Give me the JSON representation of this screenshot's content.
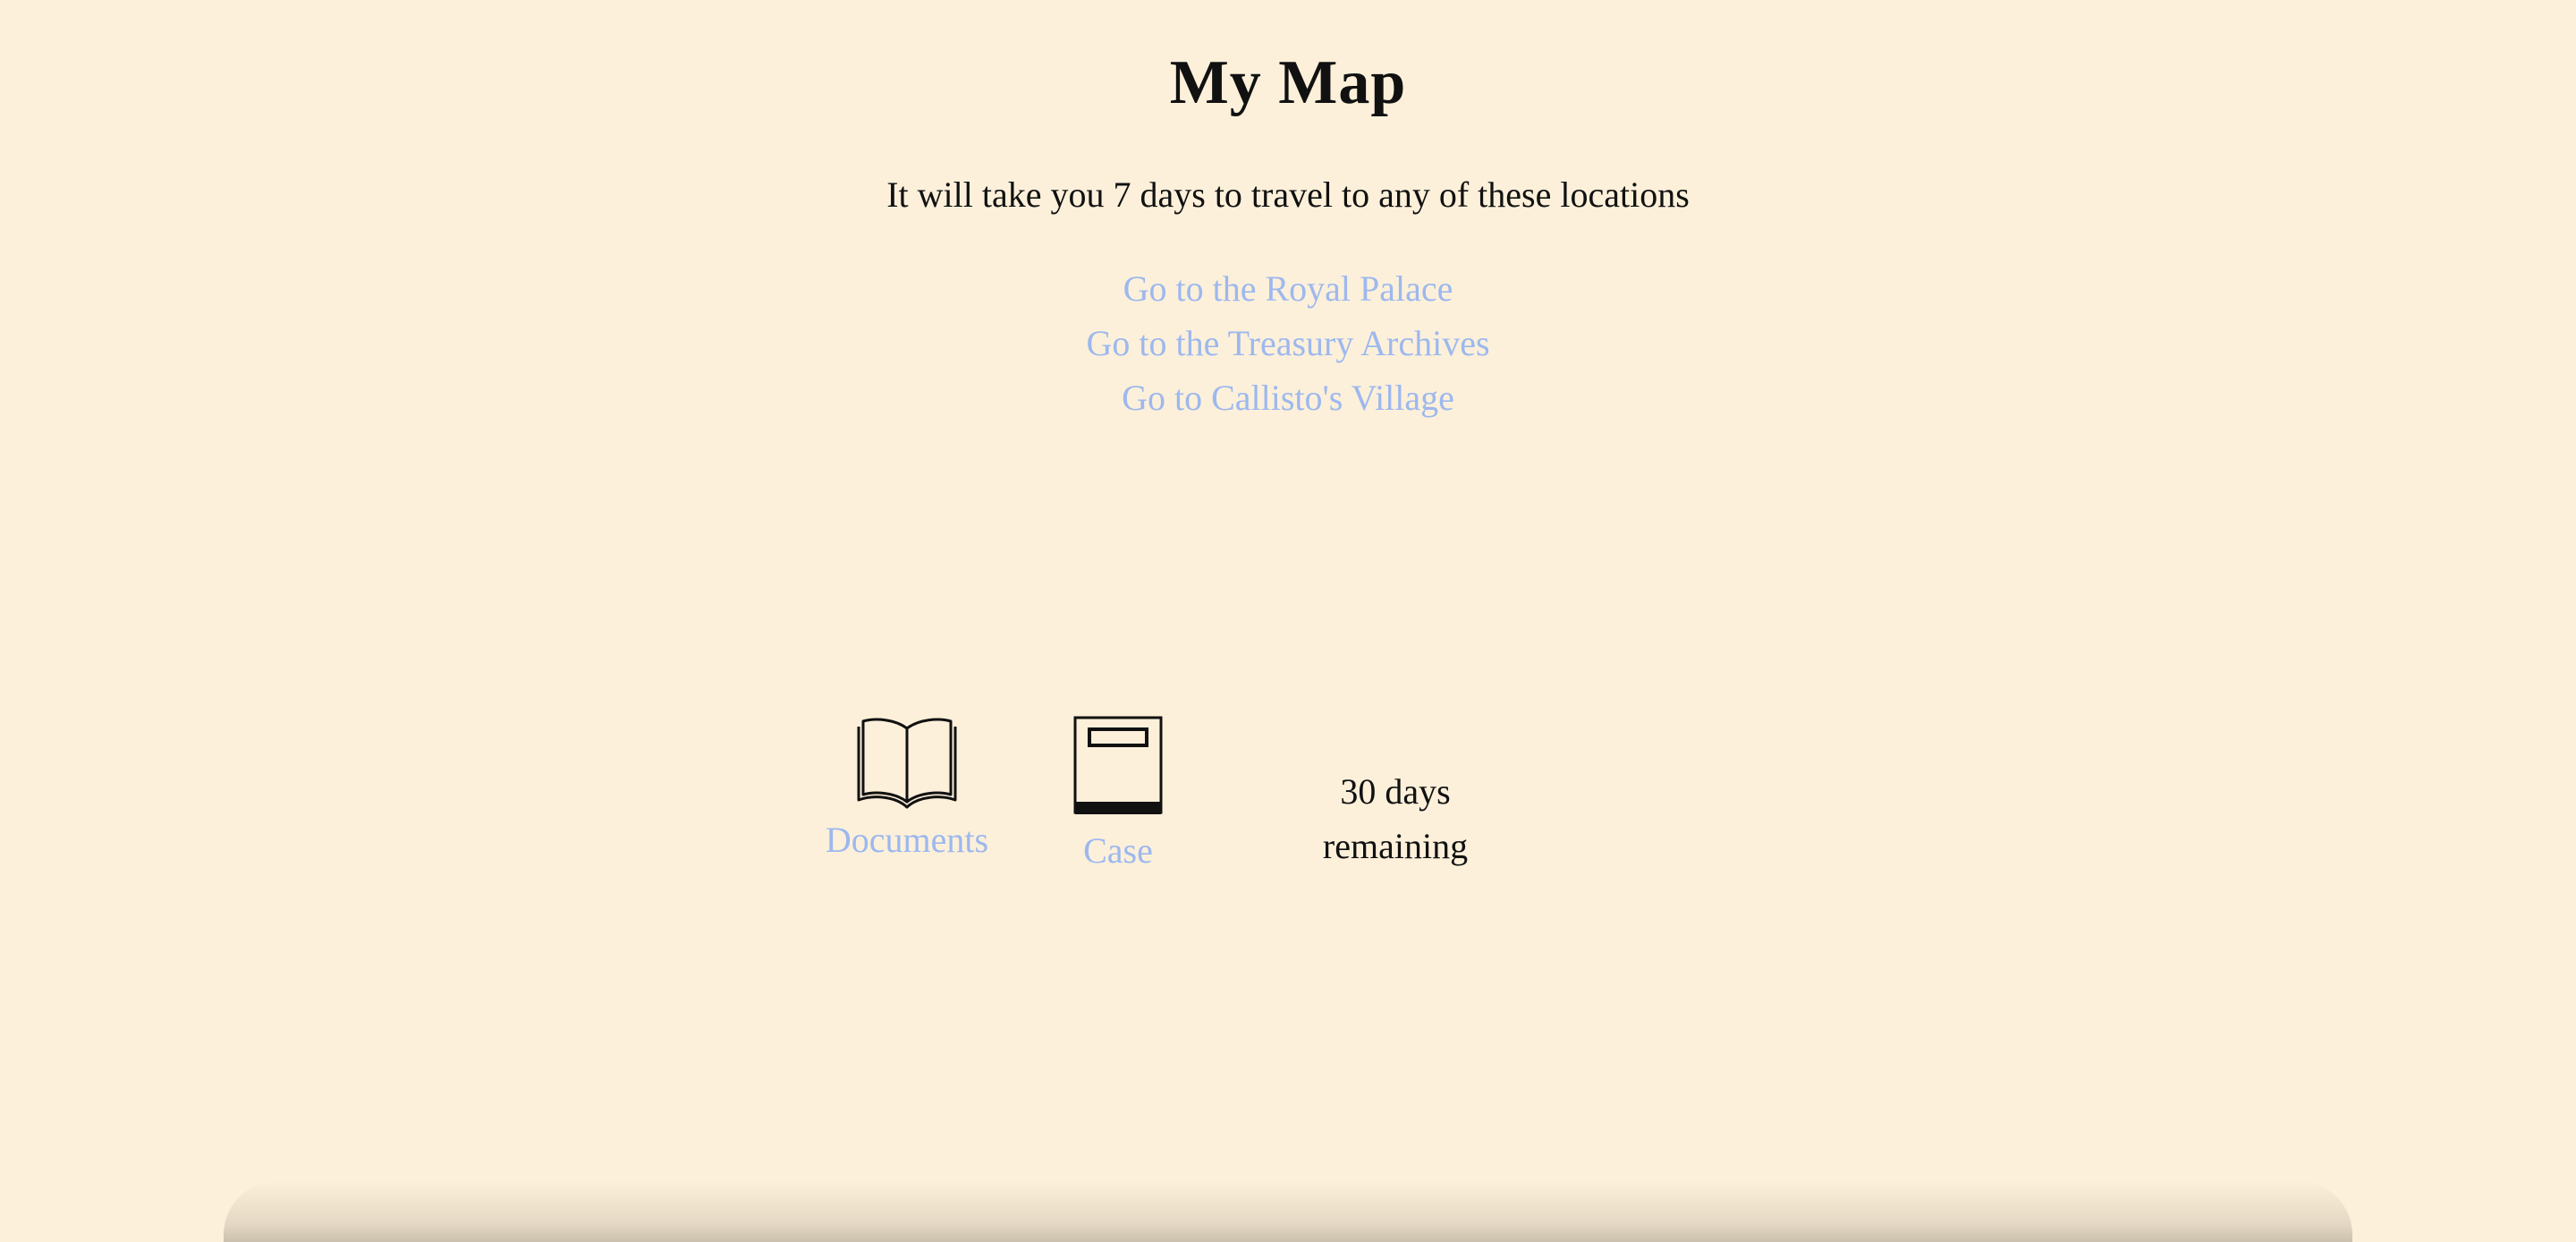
{
  "page": {
    "title": "My Map",
    "subtitle": "It will take you 7 days to travel to any of these locations"
  },
  "destinations": [
    {
      "label": "Go to the Royal Palace"
    },
    {
      "label": "Go to the Treasury Archives"
    },
    {
      "label": "Go to Callisto's Village"
    }
  ],
  "toolbar": {
    "documents": {
      "label": "Documents",
      "icon": "open-book-icon"
    },
    "case": {
      "label": "Case",
      "icon": "case-box-icon"
    },
    "days_remaining": {
      "line1": "30 days",
      "line2": "remaining"
    }
  },
  "colors": {
    "background": "#fcf0da",
    "text": "#111111",
    "link": "#9db8ee"
  }
}
